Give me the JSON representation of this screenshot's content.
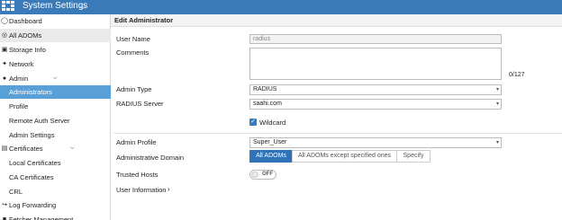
{
  "topbar": {
    "title": "System Settings",
    "chevron_icon": "chevron-down-icon"
  },
  "sidebar": {
    "items": [
      {
        "label": "Dashboard",
        "icon": "dashboard-icon"
      },
      {
        "label": "All ADOMs",
        "icon": "globe-icon"
      },
      {
        "label": "Storage Info",
        "icon": "storage-icon"
      },
      {
        "label": "Network",
        "icon": "network-icon"
      },
      {
        "label": "Admin",
        "icon": "user-icon"
      },
      {
        "label": "Administrators"
      },
      {
        "label": "Profile"
      },
      {
        "label": "Remote Auth Server"
      },
      {
        "label": "Admin Settings"
      },
      {
        "label": "Certificates",
        "icon": "certificate-icon"
      },
      {
        "label": "Local Certificates"
      },
      {
        "label": "CA Certificates"
      },
      {
        "label": "CRL"
      },
      {
        "label": "Log Forwarding",
        "icon": "log-forwarding-icon"
      },
      {
        "label": "Fetcher Management"
      }
    ]
  },
  "form": {
    "header": "Edit Administrator",
    "user_name_label": "User Name",
    "user_name_value": "radius",
    "comments_label": "Comments",
    "comments_counter": "0/127",
    "admin_type_label": "Admin Type",
    "admin_type_value": "RADIUS",
    "radius_server_label": "RADIUS Server",
    "radius_server_value": "saahi.com",
    "wildcard_label": "Wildcard",
    "wildcard_checked": true,
    "admin_profile_label": "Admin Profile",
    "admin_profile_value": "Super_User",
    "admin_domain_label": "Administrative Domain",
    "admin_domain_options": [
      "All ADOMs",
      "All ADOMs except specified ones",
      "Specify"
    ],
    "admin_domain_selected": "All ADOMs",
    "trusted_hosts_label": "Trusted Hosts",
    "trusted_hosts_toggle": "OFF",
    "user_information_label": "User Information"
  }
}
